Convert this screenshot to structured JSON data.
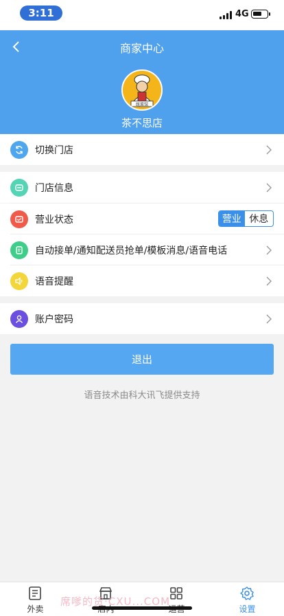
{
  "status_bar": {
    "time": "3:11",
    "network": "4G"
  },
  "header": {
    "title": "商家中心",
    "shop_name": "茶不思店",
    "avatar_text": "既菜馆"
  },
  "menu": {
    "switch_store": "切换门店",
    "store_info": "门店信息",
    "business_status": "营业状态",
    "status_open": "营业",
    "status_rest": "休息",
    "auto_settings": "自动接单/通知配送员抢单/模板消息/语音电话",
    "voice_reminder": "语音提醒",
    "account_password": "账户密码"
  },
  "logout_label": "退出",
  "credit_text": "语音技术由科大讯飞提供支持",
  "tabbar": {
    "tab1": "外卖",
    "tab2": "店内",
    "tab3": "运营",
    "tab4": "设置"
  },
  "watermark": "席嗲的货·CXU...COM",
  "colors": {
    "primary": "#4fa1ee",
    "switch_icon": "#4ea7ee",
    "store_icon": "#54d3b5",
    "status_icon": "#ef5a4a",
    "auto_icon": "#3fce8a",
    "voice_icon": "#f2d63a",
    "account_icon": "#6b4fe0"
  }
}
